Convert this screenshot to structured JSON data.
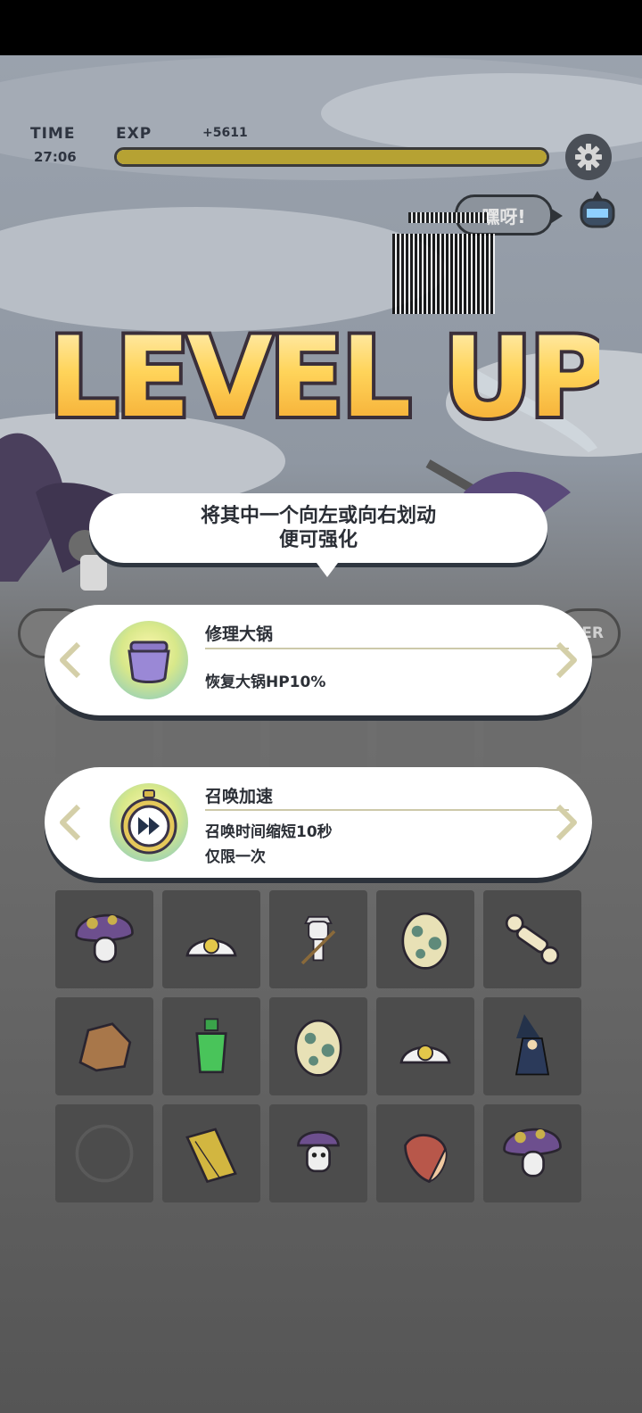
{
  "hud": {
    "time_label": "TIME",
    "time_value": "27:06",
    "exp_label": "EXP",
    "exp_gain": "+5611",
    "exp_progress": 1.0,
    "settings_icon": "gear-icon"
  },
  "speech_bubble": "嘿呀!",
  "banner": {
    "text": "LEVEL UP"
  },
  "tip": {
    "line1": "将其中一个向左或向右划动",
    "line2": "便可强化"
  },
  "upgrades": [
    {
      "icon": "pot-icon",
      "title": "修理大锅",
      "desc_line1": "恢复大锅HP10%",
      "desc_line2": ""
    },
    {
      "icon": "stopwatch-fast-forward-icon",
      "title": "召唤加速",
      "desc_line1": "召唤时间缩短10秒",
      "desc_line2": "仅限一次"
    }
  ],
  "side_button_partial": "ER",
  "inventory_icons": [
    "mushroom-icon",
    "fried-egg-icon",
    "viking-skeleton-icon",
    "spotted-egg-icon",
    "bone-icon",
    "rock-icon",
    "green-potion-icon",
    "spotted-egg-icon",
    "fried-egg-icon",
    "witch-icon",
    "empty-slot-icon",
    "broom-icon",
    "mushroom-creature-icon",
    "meat-icon",
    "mushroom-icon"
  ],
  "colors": {
    "exp_fill": "#b6a233",
    "card_bg": "#ffffff",
    "text_dark": "#2b2f36",
    "level_up_fill": "#f6b53a"
  }
}
